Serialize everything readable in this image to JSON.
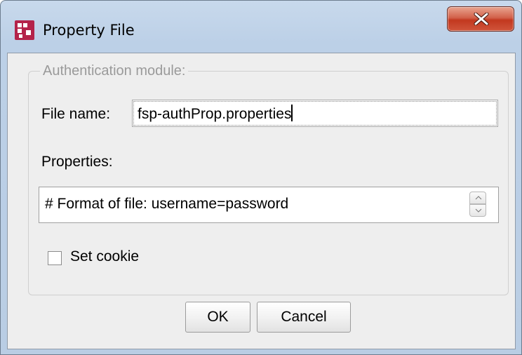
{
  "window": {
    "title": "Property File",
    "close_icon": "close-x-icon",
    "app_icon": "app-logo-icon",
    "app_icon_color": "#b4234a"
  },
  "form": {
    "group_legend": "Authentication module:",
    "file_name_label": "File name:",
    "file_name_value": "fsp-authProp.properties",
    "properties_label": "Properties:",
    "properties_value": "# Format of file: username=password",
    "set_cookie_label": "Set cookie",
    "set_cookie_checked": false
  },
  "buttons": {
    "ok_label": "OK",
    "cancel_label": "Cancel"
  }
}
